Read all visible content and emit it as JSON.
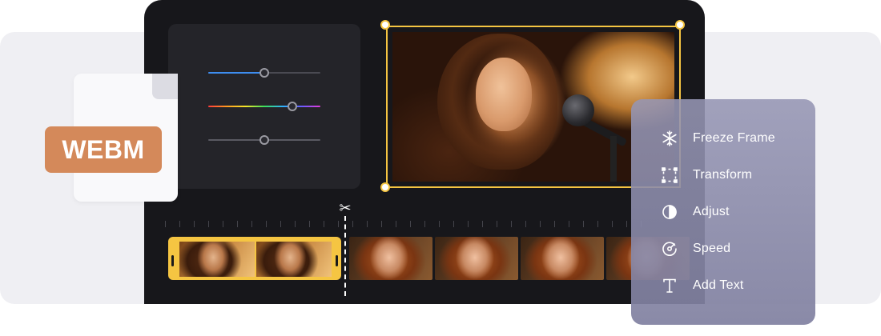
{
  "file_badge": {
    "format": "WEBM"
  },
  "adjust_panel": {
    "sliders": [
      {
        "name": "blue-slider",
        "value": 0.5,
        "color": "#3e8df0"
      },
      {
        "name": "hue-slider",
        "value": 0.75
      },
      {
        "name": "gray-slider",
        "value": 0.5
      }
    ]
  },
  "preview": {
    "accent": "#f5c542"
  },
  "timeline": {
    "selected_clip_frames": 2,
    "strip_frames": 4
  },
  "context_menu": {
    "items": [
      {
        "label": "Freeze Frame",
        "icon": "snowflake-icon"
      },
      {
        "label": "Transform",
        "icon": "transform-icon"
      },
      {
        "label": "Adjust",
        "icon": "adjust-icon"
      },
      {
        "label": "Speed",
        "icon": "speed-icon"
      },
      {
        "label": "Add Text",
        "icon": "text-icon"
      }
    ]
  }
}
